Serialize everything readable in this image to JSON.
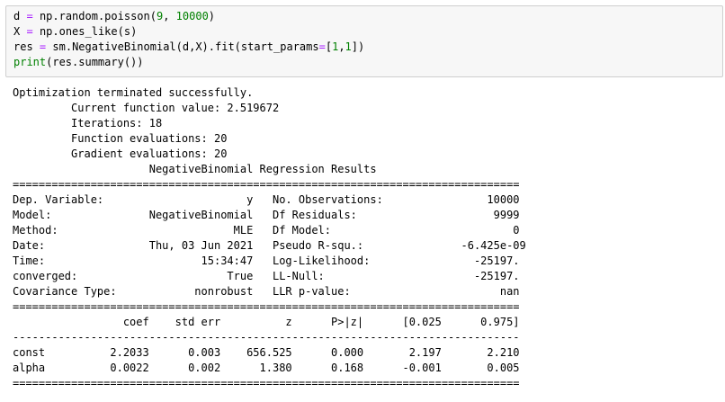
{
  "input_cell": {
    "lines": [
      {
        "p1": "d",
        "op1": "=",
        "p2": "np.random.poisson(",
        "n1": "9",
        "p3": ", ",
        "n2": "10000",
        "p4": ")"
      },
      {
        "p1": "X",
        "op1": "=",
        "p2": "np.ones_like(s)"
      },
      {
        "p1": "res",
        "op1": "=",
        "p2": "sm.NegativeBinomial(d,X).fit(start_params",
        "op2": "=",
        "p3": "[",
        "n1": "1",
        "p4": ",",
        "n2": "1",
        "p5": "])"
      },
      {
        "fn": "print",
        "p2": "(res.summary())"
      }
    ]
  },
  "output": {
    "lines": [
      "Optimization terminated successfully.",
      "         Current function value: 2.519672",
      "         Iterations: 18",
      "         Function evaluations: 20",
      "         Gradient evaluations: 20",
      "                     NegativeBinomial Regression Results                      ",
      "==============================================================================",
      "Dep. Variable:                      y   No. Observations:                10000",
      "Model:               NegativeBinomial   Df Residuals:                     9999",
      "Method:                           MLE   Df Model:                            0",
      "Date:                Thu, 03 Jun 2021   Pseudo R-squ.:               -6.425e-09",
      "Time:                        15:34:47   Log-Likelihood:                -25197.",
      "converged:                       True   LL-Null:                       -25197.",
      "Covariance Type:            nonrobust   LLR p-value:                       nan",
      "==============================================================================",
      "                 coef    std err          z      P>|z|      [0.025      0.975]",
      "------------------------------------------------------------------------------",
      "const          2.2033      0.003    656.525      0.000       2.197       2.210",
      "alpha          0.0022      0.002      1.380      0.168      -0.001       0.005",
      "=============================================================================="
    ]
  }
}
